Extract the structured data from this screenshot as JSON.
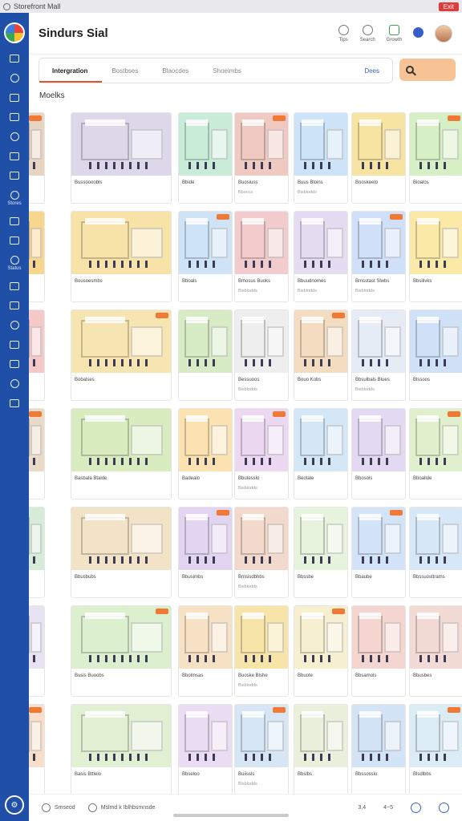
{
  "window": {
    "title": "Storefront Mall",
    "close_label": "Exit"
  },
  "header": {
    "title": "Sindurs Sial",
    "icons": [
      {
        "name": "bulb-icon",
        "label": "Tips"
      },
      {
        "name": "search-icon",
        "label": "Search"
      },
      {
        "name": "growth-icon",
        "label": "Growth"
      }
    ]
  },
  "sidebar": {
    "items": [
      {
        "icon": "home-icon",
        "label": ""
      },
      {
        "icon": "layout-icon",
        "label": ""
      },
      {
        "icon": "truck-icon",
        "label": ""
      },
      {
        "icon": "calendar-icon",
        "label": ""
      },
      {
        "icon": "chat-icon",
        "label": ""
      },
      {
        "icon": "camera-icon",
        "label": ""
      },
      {
        "icon": "globe-icon",
        "label": ""
      },
      {
        "icon": "folder-icon",
        "label": "Stores"
      },
      {
        "icon": "pin-icon",
        "label": ""
      },
      {
        "icon": "grid-icon",
        "label": ""
      },
      {
        "icon": "clock-icon",
        "label": "Status"
      },
      {
        "icon": "doc-icon",
        "label": ""
      },
      {
        "icon": "tools-icon",
        "label": ""
      },
      {
        "icon": "flag-icon",
        "label": ""
      },
      {
        "icon": "mail-icon",
        "label": ""
      },
      {
        "icon": "star-icon",
        "label": ""
      },
      {
        "icon": "lock-icon",
        "label": ""
      },
      {
        "icon": "settings-icon",
        "label": ""
      }
    ],
    "bottom_label": "Settings"
  },
  "tabs": [
    {
      "label": "Intergration",
      "active": true
    },
    {
      "label": "Bostbses",
      "active": false
    },
    {
      "label": "Blaocdes",
      "active": false
    },
    {
      "label": "Shoeimbs",
      "active": false
    }
  ],
  "tabs_more": "Dees",
  "section_title": "Moelks",
  "cards": [
    {
      "name": "",
      "sub": "",
      "color": "#e8d4c2"
    },
    {
      "name": "Bussoooobls",
      "sub": "",
      "color": "#dcd8ea"
    },
    {
      "name": "Bbide",
      "sub": "",
      "color": "#c9ecd9"
    },
    {
      "name": "Buosiuss",
      "sub": "Bboccs",
      "color": "#f0c9c1"
    },
    {
      "name": "Buus Bloins",
      "sub": "Bisblodds",
      "color": "#cde3f7"
    },
    {
      "name": "Booskeelo",
      "sub": "",
      "color": "#f7e3a2"
    },
    {
      "name": "Bioalos",
      "sub": "",
      "color": "#d6efc4"
    },
    {
      "name": "Blusoules",
      "sub": "",
      "color": "#f4d9b1"
    },
    {
      "name": "",
      "sub": "",
      "color": "#f9d68e"
    },
    {
      "name": "Bousoesmbs",
      "sub": "",
      "color": "#f7e2a7"
    },
    {
      "name": "Bboals",
      "sub": "",
      "color": "#cfe3f7"
    },
    {
      "name": "Bmosus Buoks",
      "sub": "Bisblodds",
      "color": "#f2cccc"
    },
    {
      "name": "Bbuudnomes",
      "sub": "Bisblodds",
      "color": "#e6dcf2"
    },
    {
      "name": "Bmsstast Slwbs",
      "sub": "Bisblodds",
      "color": "#cfe0f8"
    },
    {
      "name": "Bbsilivks",
      "sub": "",
      "color": "#fbe9a8"
    },
    {
      "name": "Bbile",
      "sub": "",
      "color": "#d7e4f3"
    },
    {
      "name": "",
      "sub": "",
      "color": "#f6c9c9"
    },
    {
      "name": "Bobalses",
      "sub": "",
      "color": "#f6e5b0"
    },
    {
      "name": "",
      "sub": "",
      "color": "#d7ecc5"
    },
    {
      "name": "Bessuoos",
      "sub": "Bisblodds",
      "color": "#eeeeee"
    },
    {
      "name": "Bouo Kobs",
      "sub": "",
      "color": "#f4dcc0"
    },
    {
      "name": "Bbsulbals Blues",
      "sub": "Bisblodds",
      "color": "#e6ecf5"
    },
    {
      "name": "Blssoos",
      "sub": "",
      "color": "#cfe1f6"
    },
    {
      "name": "Bbailes",
      "sub": "",
      "color": "#f8d6cb"
    },
    {
      "name": "",
      "sub": "",
      "color": "#eadbc8"
    },
    {
      "name": "Basbala Btalde",
      "sub": "",
      "color": "#d8ecbf"
    },
    {
      "name": "Badealo",
      "sub": "",
      "color": "#fbe2b0"
    },
    {
      "name": "Bbutesslo",
      "sub": "Bisblodds",
      "color": "#ecd9f1"
    },
    {
      "name": "Beotale",
      "sub": "",
      "color": "#d3e7f6"
    },
    {
      "name": "Bbosols",
      "sub": "",
      "color": "#e4d9f3"
    },
    {
      "name": "Bboallde",
      "sub": "",
      "color": "#e0f0cc"
    },
    {
      "name": "Bbuislso",
      "sub": "",
      "color": "#d9e7f5"
    },
    {
      "name": "",
      "sub": "",
      "color": "#d6ecd9"
    },
    {
      "name": "Bbusbubs",
      "sub": "",
      "color": "#f3e3c6"
    },
    {
      "name": "Bbusimbs",
      "sub": "",
      "color": "#e2d5f1"
    },
    {
      "name": "Bmsisdbhbs",
      "sub": "Bisblodds",
      "color": "#f2d9cb"
    },
    {
      "name": "Bbssbe",
      "sub": "",
      "color": "#e8f3dd"
    },
    {
      "name": "Bbaube",
      "sub": "",
      "color": "#d3e4f8"
    },
    {
      "name": "Bbssuosttrams",
      "sub": "",
      "color": "#d6e7f7"
    },
    {
      "name": "",
      "sub": "",
      "color": "#e6f1f8"
    },
    {
      "name": "",
      "sub": "",
      "color": "#e7e3f3"
    },
    {
      "name": "Busis Buoobs",
      "sub": "",
      "color": "#dcefcf"
    },
    {
      "name": "Bbolmsas",
      "sub": "",
      "color": "#f7e1c4"
    },
    {
      "name": "Buoske Blshe",
      "sub": "Bisblodds",
      "color": "#f6e4a9"
    },
    {
      "name": "Bbuote",
      "sub": "",
      "color": "#f7f0d0"
    },
    {
      "name": "Bbsamols",
      "sub": "",
      "color": "#f5d5cf"
    },
    {
      "name": "Bbusbes",
      "sub": "",
      "color": "#f3dbd5"
    },
    {
      "name": "",
      "sub": "",
      "color": "#f7e6d3"
    },
    {
      "name": "",
      "sub": "",
      "color": "#f9dfc9"
    },
    {
      "name": "Basis Bttlelo",
      "sub": "",
      "color": "#e1f0d3"
    },
    {
      "name": "Bbseloo",
      "sub": "",
      "color": "#eadcf3"
    },
    {
      "name": "Buiissls",
      "sub": "Bisblodds",
      "color": "#d7e6f4"
    },
    {
      "name": "Bbslbs",
      "sub": "",
      "color": "#eaf0dc"
    },
    {
      "name": "Bbssosslo",
      "sub": "",
      "color": "#d4e4f7"
    },
    {
      "name": "Blsdlbbs",
      "sub": "",
      "color": "#dbecf5"
    },
    {
      "name": "",
      "sub": "",
      "color": "#e5f0e1"
    }
  ],
  "bottombar": {
    "left_label": "Smseod",
    "mid_label": "Mslmd k Iblhbsmnsde",
    "right_labels": [
      "3.4",
      "4~5"
    ]
  }
}
